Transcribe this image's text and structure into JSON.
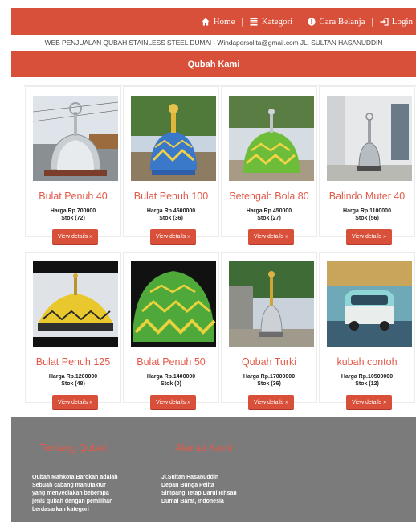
{
  "nav": {
    "items": [
      {
        "label": "Home",
        "icon": "home-icon"
      },
      {
        "label": "Kategori",
        "icon": "list-icon"
      },
      {
        "label": "Cara Belanja",
        "icon": "info-icon"
      },
      {
        "label": "Login",
        "icon": "login-icon"
      }
    ],
    "separator": "|"
  },
  "subheader": "WEB PENJUALAN QUBAH STAINLESS STEEL DUMAI - Windapersolita@gmail.com JL. SULTAN HASANUDDIN",
  "section_title": "Qubah Kami",
  "products": [
    {
      "name": "Bulat Penuh 40",
      "price": "Harga Rp.700000",
      "stock": "Stok (72)",
      "button": "View details »"
    },
    {
      "name": "Bulat Penuh 100",
      "price": "Harga Rp.4500000",
      "stock": "Stok (36)",
      "button": "View details »"
    },
    {
      "name": "Setengah Bola 80",
      "price": "Harga Rp.450000",
      "stock": "Stok (27)",
      "button": "View details »"
    },
    {
      "name": "Balindo Muter 40",
      "price": "Harga Rp.1100000",
      "stock": "Stok (56)",
      "button": "View details »"
    },
    {
      "name": "Bulat Penuh 125",
      "price": "Harga Rp.1200000",
      "stock": "Stok (48)",
      "button": "View details »"
    },
    {
      "name": "Bulat Penuh 50",
      "price": "Harga Rp.1400000",
      "stock": "Stok (0)",
      "button": "View details »"
    },
    {
      "name": "Qubah Turki",
      "price": "Harga Rp.17000000",
      "stock": "Stok (36)",
      "button": "View details »"
    },
    {
      "name": "kubah contoh",
      "price": "Harga Rp.10500000",
      "stock": "Stok (12)",
      "button": "View details »"
    }
  ],
  "footer": {
    "about": {
      "title": "Tentang Qubah",
      "lines": [
        "Qubah Mahkota Barokah adalah",
        "Sebuah cabang manufaktur",
        "yang menyediakan beberapa",
        "jenis qubah dengan pemilihan",
        "berdasarkan kategori"
      ]
    },
    "address": {
      "title": "Alamat Kami",
      "lines": [
        "Jl.Sultan Hasanuddin",
        "Depan Bunga Pelita",
        "Simpang Tetap Darul Ichsan",
        "Dumai Barat, Indonesia"
      ]
    }
  },
  "colors": {
    "accent": "#d9503a",
    "title": "#e35a4a",
    "footer": "#7b7b7b"
  }
}
